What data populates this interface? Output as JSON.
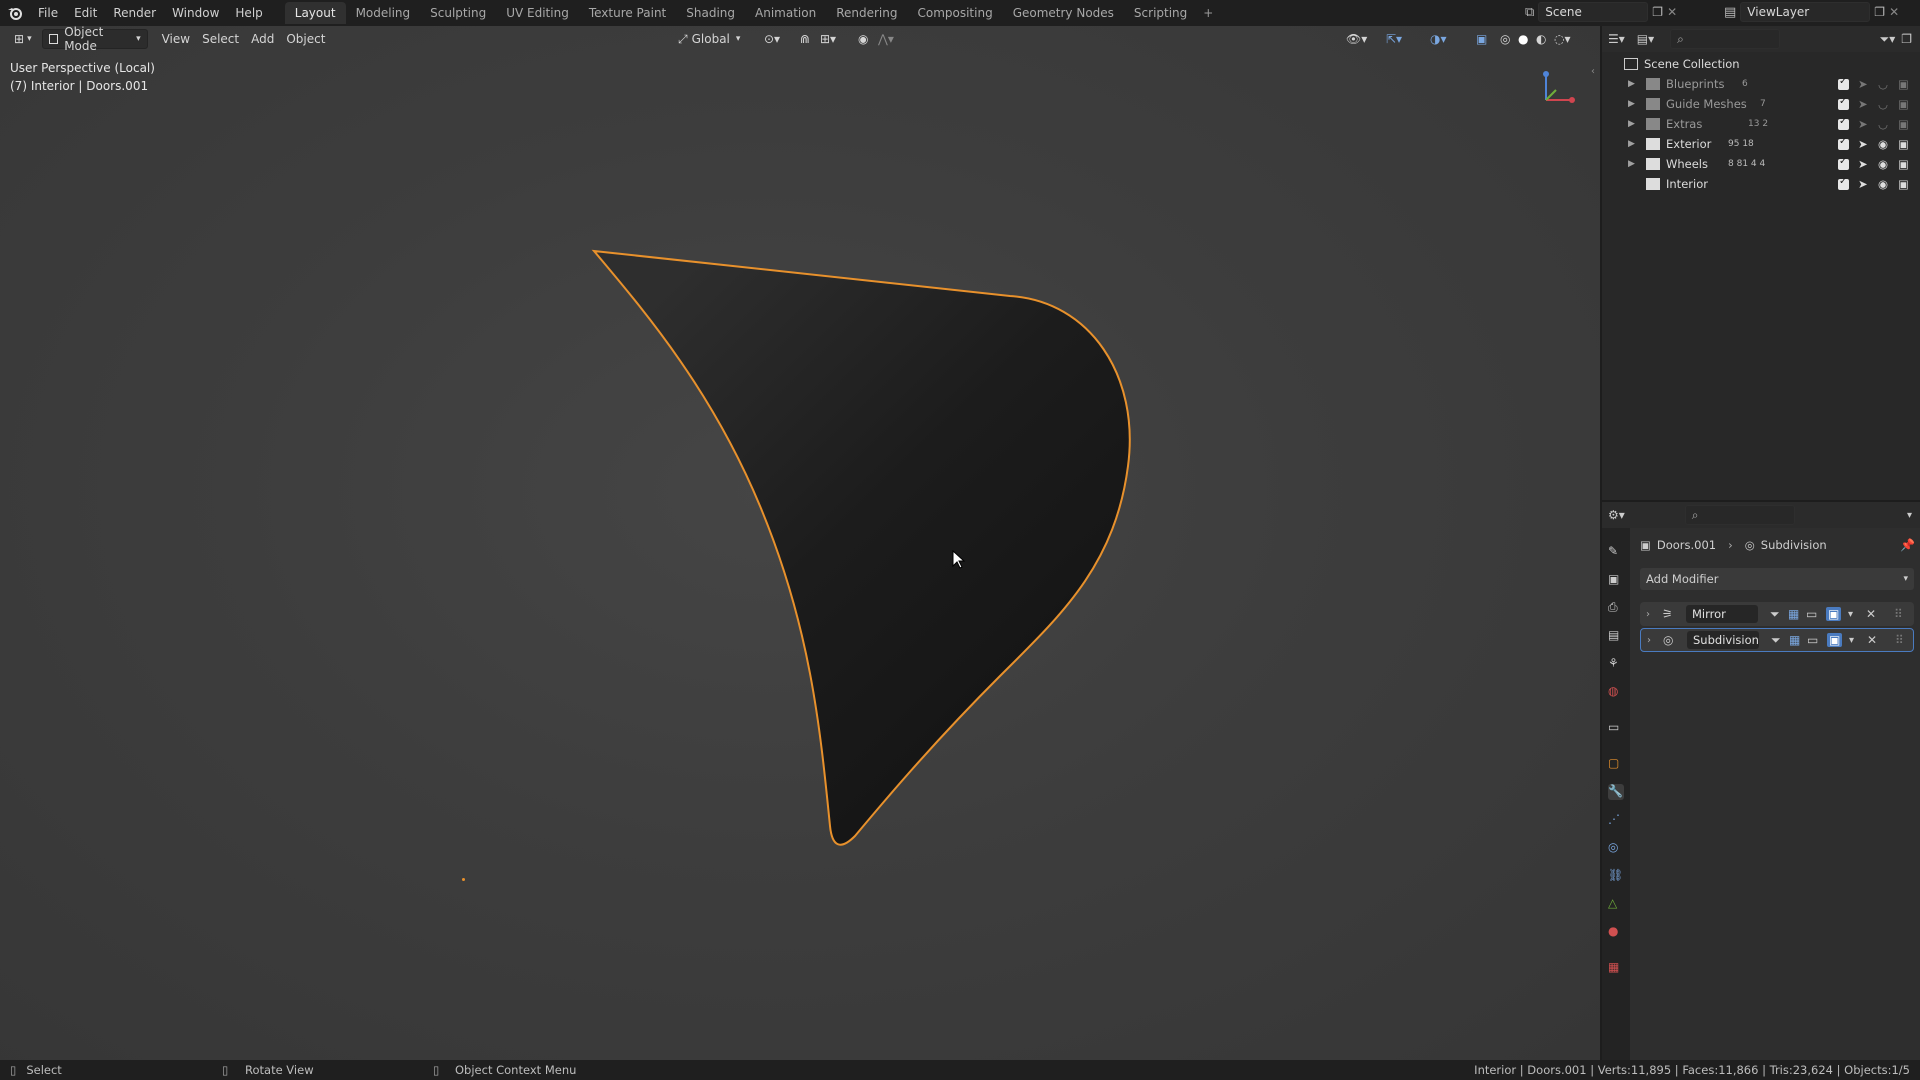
{
  "menu": [
    "File",
    "Edit",
    "Render",
    "Window",
    "Help"
  ],
  "workspaces": [
    "Layout",
    "Modeling",
    "Sculpting",
    "UV Editing",
    "Texture Paint",
    "Shading",
    "Animation",
    "Rendering",
    "Compositing",
    "Geometry Nodes",
    "Scripting"
  ],
  "active_workspace": "Layout",
  "scene_name": "Scene",
  "view_layer_name": "ViewLayer",
  "viewport": {
    "mode": "Object Mode",
    "menus": [
      "View",
      "Select",
      "Add",
      "Object"
    ],
    "transform_orientation": "Global",
    "view_name": "User Perspective (Local)",
    "object_info": "(7) Interior | Doors.001",
    "selection_color": "#e8912c"
  },
  "outliner": {
    "root": "Scene Collection",
    "collections": [
      {
        "name": "Blueprints",
        "counts": "6",
        "dim": true
      },
      {
        "name": "Guide Meshes",
        "counts": "7",
        "dim": true
      },
      {
        "name": "Extras",
        "counts": "13 2",
        "dim": true
      },
      {
        "name": "Exterior",
        "counts": "95 18",
        "dim": false
      },
      {
        "name": "Wheels",
        "counts": "8 81 4 4",
        "dim": false
      },
      {
        "name": "Interior",
        "counts": "",
        "dim": false
      }
    ]
  },
  "properties": {
    "breadcrumb_object": "Doors.001",
    "breadcrumb_modifier": "Subdivision",
    "add_modifier_label": "Add Modifier",
    "modifiers": [
      {
        "name": "Mirror",
        "active": false
      },
      {
        "name": "Subdivision",
        "active": true
      }
    ]
  },
  "status": {
    "left_action": "Select",
    "middle_action": "Rotate View",
    "right_action": "Object Context Menu",
    "stats": "Interior | Doors.001 | Verts:11,895 | Faces:11,866 | Tris:23,624 | Objects:1/5"
  }
}
